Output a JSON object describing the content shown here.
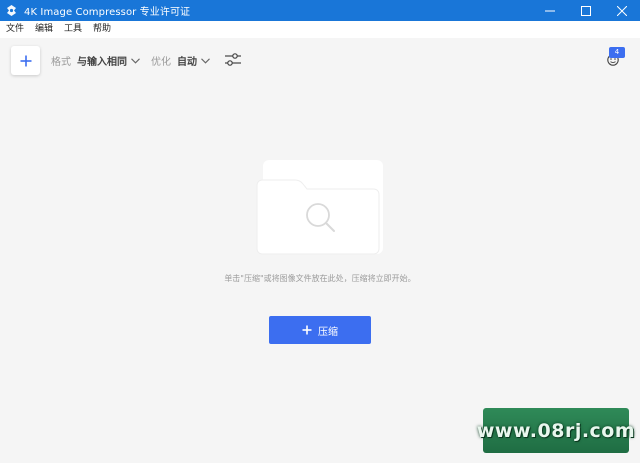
{
  "window": {
    "title": "4K Image Compressor 专业许可证",
    "minimize_icon": "minimize-icon",
    "maximize_icon": "maximize-icon",
    "close_icon": "close-icon",
    "accent": "#1976d8"
  },
  "menu": {
    "items": [
      "文件",
      "编辑",
      "工具",
      "帮助"
    ]
  },
  "toolbar": {
    "add_icon": "plus-icon",
    "format": {
      "label": "格式",
      "value": "与输入相同"
    },
    "optimize": {
      "label": "优化",
      "value": "自动"
    },
    "settings_icon": "sliders-icon",
    "account_icon": "account-icon",
    "badge": "4"
  },
  "main": {
    "illustration": "folder-search-icon",
    "hint": "单击\"压缩\"或将图像文件放在此处，压缩将立即开始。",
    "compress_label": "压缩",
    "button_color": "#3c6ef0"
  },
  "watermark": {
    "text": "www.08rj.com"
  }
}
